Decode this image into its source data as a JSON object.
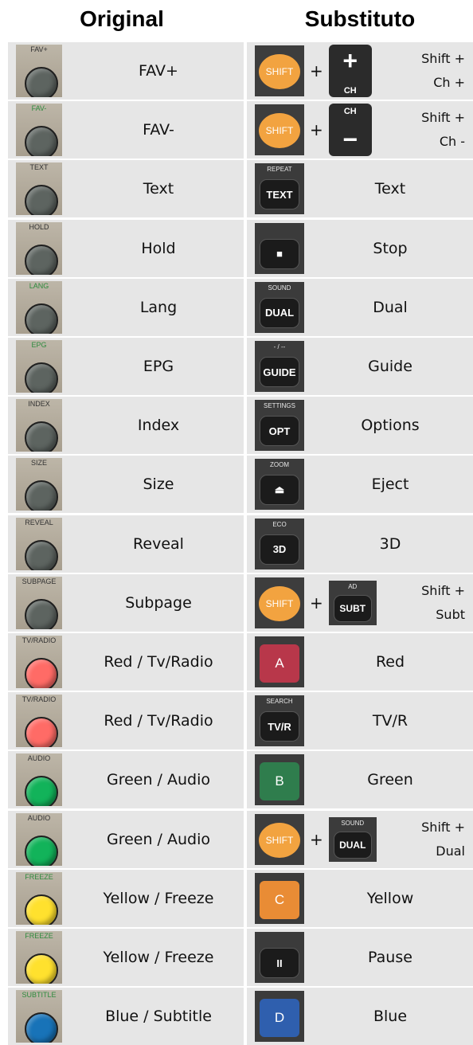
{
  "headers": {
    "original": "Original",
    "substitute": "Substituto"
  },
  "rows": [
    {
      "orig_label": "FAV+",
      "knob": "grey",
      "green_label": false,
      "name": "FAV+",
      "sub": {
        "type": "combo",
        "second": {
          "kind": "ch",
          "sign": "+",
          "label": "CH"
        },
        "text_line1": "Shift +",
        "text_line2": "Ch +"
      }
    },
    {
      "orig_label": "FAV-",
      "knob": "grey",
      "green_label": true,
      "name": "FAV-",
      "sub": {
        "type": "combo",
        "second": {
          "kind": "ch",
          "sign": "−",
          "label": "CH"
        },
        "text_line1": "Shift +",
        "text_line2": "Ch -"
      }
    },
    {
      "orig_label": "TEXT",
      "knob": "grey",
      "green_label": false,
      "name": "Text",
      "sub": {
        "type": "btn",
        "sup": "REPEAT",
        "label": "TEXT",
        "text": "Text"
      }
    },
    {
      "orig_label": "HOLD",
      "knob": "grey",
      "green_label": false,
      "name": "Hold",
      "sub": {
        "type": "btn",
        "sup": "",
        "label": "■",
        "text": "Stop"
      }
    },
    {
      "orig_label": "LANG",
      "knob": "grey",
      "green_label": true,
      "name": "Lang",
      "sub": {
        "type": "btn",
        "sup": "SOUND",
        "label": "DUAL",
        "text": "Dual"
      }
    },
    {
      "orig_label": "EPG",
      "knob": "grey",
      "green_label": true,
      "name": "EPG",
      "sub": {
        "type": "btn",
        "sup": "- / --",
        "label": "GUIDE",
        "text": "Guide"
      }
    },
    {
      "orig_label": "INDEX",
      "knob": "grey",
      "green_label": false,
      "name": "Index",
      "sub": {
        "type": "btn",
        "sup": "SETTINGS",
        "label": "OPT",
        "text": "Options"
      }
    },
    {
      "orig_label": "SIZE",
      "knob": "grey",
      "green_label": false,
      "name": "Size",
      "sub": {
        "type": "btn",
        "sup": "ZOOM",
        "label": "⏏",
        "text": "Eject"
      }
    },
    {
      "orig_label": "REVEAL",
      "knob": "grey",
      "green_label": false,
      "name": "Reveal",
      "sub": {
        "type": "btn",
        "sup": "ECO",
        "label": "3D",
        "text": "3D"
      }
    },
    {
      "orig_label": "SUBPAGE",
      "knob": "grey",
      "green_label": false,
      "name": "Subpage",
      "sub": {
        "type": "combo",
        "second": {
          "kind": "btn",
          "sup": "AD",
          "label": "SUBT"
        },
        "text_line1": "Shift +",
        "text_line2": "Subt"
      }
    },
    {
      "orig_label": "TV/RADIO",
      "knob": "red",
      "green_label": false,
      "name": "Red / Tv/Radio",
      "sub": {
        "type": "color",
        "color": "#b8374a",
        "label": "A",
        "text": "Red"
      }
    },
    {
      "orig_label": "TV/RADIO",
      "knob": "red",
      "green_label": false,
      "name": "Red / Tv/Radio",
      "sub": {
        "type": "btn",
        "sup": "SEARCH",
        "label": "TV/R",
        "text": "TV/R"
      }
    },
    {
      "orig_label": "AUDIO",
      "knob": "green",
      "green_label": false,
      "name": "Green / Audio",
      "sub": {
        "type": "color",
        "color": "#2f7d4d",
        "label": "B",
        "text": "Green"
      }
    },
    {
      "orig_label": "AUDIO",
      "knob": "green",
      "green_label": false,
      "name": "Green / Audio",
      "sub": {
        "type": "combo",
        "second": {
          "kind": "btn",
          "sup": "SOUND",
          "label": "DUAL"
        },
        "text_line1": "Shift +",
        "text_line2": "Dual"
      }
    },
    {
      "orig_label": "FREEZE",
      "knob": "yellow",
      "green_label": true,
      "name": "Yellow / Freeze",
      "sub": {
        "type": "color",
        "color": "#e98c35",
        "label": "C",
        "text": "Yellow"
      }
    },
    {
      "orig_label": "FREEZE",
      "knob": "yellow",
      "green_label": true,
      "name": "Yellow / Freeze",
      "sub": {
        "type": "btn",
        "sup": "",
        "label": "II",
        "text": "Pause"
      }
    },
    {
      "orig_label": "SUBTITLE",
      "knob": "blue",
      "green_label": true,
      "name": "Blue / Subtitle",
      "sub": {
        "type": "color",
        "color": "#2f5fae",
        "label": "D",
        "text": "Blue"
      }
    }
  ],
  "shift_label": "SHIFT",
  "plus_sign": "+"
}
